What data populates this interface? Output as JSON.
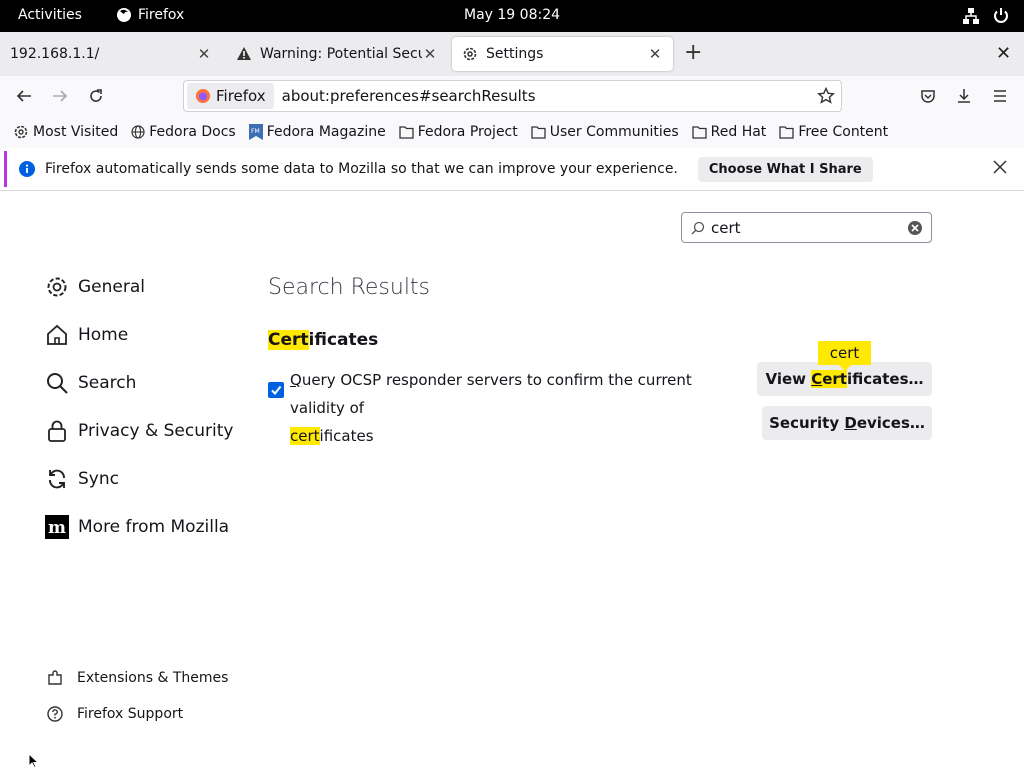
{
  "topbar": {
    "activities": "Activities",
    "app_name": "Firefox",
    "clock": "May 19  08:24"
  },
  "tabs": [
    {
      "title": "192.168.1.1/",
      "active": false
    },
    {
      "title": "Warning: Potential Securi",
      "active": false
    },
    {
      "title": "Settings",
      "active": true
    }
  ],
  "navbar": {
    "identity_label": "Firefox",
    "url": "about:preferences#searchResults"
  },
  "bookmarks": [
    {
      "label": "Most Visited",
      "icon": "gear-icon"
    },
    {
      "label": "Fedora Docs",
      "icon": "globe-icon"
    },
    {
      "label": "Fedora Magazine",
      "icon": "fm-icon"
    },
    {
      "label": "Fedora Project",
      "icon": "folder-icon"
    },
    {
      "label": "User Communities",
      "icon": "folder-icon"
    },
    {
      "label": "Red Hat",
      "icon": "folder-icon"
    },
    {
      "label": "Free Content",
      "icon": "folder-icon"
    }
  ],
  "notice": {
    "text": "Firefox automatically sends some data to Mozilla so that we can improve your experience.",
    "button": "Choose What I Share"
  },
  "pref_search": {
    "value": "cert"
  },
  "categories": [
    {
      "label": "General",
      "icon": "gear-icon"
    },
    {
      "label": "Home",
      "icon": "home-icon"
    },
    {
      "label": "Search",
      "icon": "search-icon"
    },
    {
      "label": "Privacy & Security",
      "icon": "lock-icon"
    },
    {
      "label": "Sync",
      "icon": "sync-icon"
    },
    {
      "label": "More from Mozilla",
      "icon": "mozilla-icon"
    }
  ],
  "footer_links": [
    {
      "label": "Extensions & Themes",
      "icon": "puzzle-icon"
    },
    {
      "label": "Firefox Support",
      "icon": "help-icon"
    }
  ],
  "results": {
    "heading": "Search Results",
    "section_hl": "Cert",
    "section_rest": "ificates",
    "ocsp_q": "Q",
    "ocsp_line1_rest": "uery OCSP responder servers to confirm the current validity of",
    "ocsp_hl": "cert",
    "ocsp_line2_rest": "ificates",
    "ocsp_checked": true,
    "view_cert_pre": "View ",
    "view_cert_c": "C",
    "view_cert_hl_rest": "ert",
    "view_cert_post": "ificates…",
    "sec_dev_pre": "Security ",
    "sec_dev_d": "D",
    "sec_dev_post": "evices…",
    "tooltip": "cert"
  },
  "colors": {
    "accent": "#0061e0",
    "highlight": "#ffe900",
    "notice_border": "#b833e1"
  }
}
